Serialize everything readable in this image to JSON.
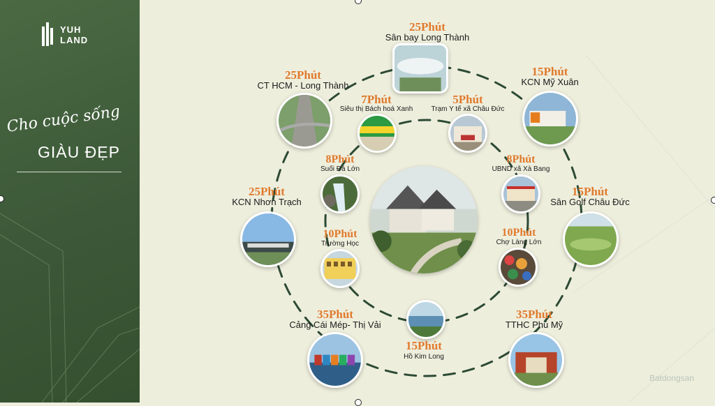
{
  "brand": {
    "line1": "YUH",
    "line2": "LAND"
  },
  "tagline": {
    "script": "Cho cuộc sống",
    "caps": "GIÀU ĐẸP"
  },
  "center": {
    "label": "center-house-render"
  },
  "destinations": [
    {
      "id": "san-bay",
      "time": "25Phút",
      "name": "Sân bay Long Thành"
    },
    {
      "id": "kcn-my-xuan",
      "time": "15Phút",
      "name": "KCN Mỹ Xuân"
    },
    {
      "id": "ct-hcm",
      "time": "25Phút",
      "name": "CT HCM - Long Thành"
    },
    {
      "id": "bach-hoa-xanh",
      "time": "7Phút",
      "name": "Siêu thị Bách hoá Xanh"
    },
    {
      "id": "tram-y-te",
      "time": "5Phút",
      "name": "Trạm Y tế xã Châu Đức"
    },
    {
      "id": "suoi-da-lon",
      "time": "8Phút",
      "name": "Suối Đá Lớn"
    },
    {
      "id": "ubnd",
      "time": "8Phút",
      "name": "UBND xã Xà Bang"
    },
    {
      "id": "kcn-nhon-trach",
      "time": "25Phút",
      "name": "KCN Nhơn Trạch"
    },
    {
      "id": "golf",
      "time": "15Phút",
      "name": "Sân Golf Châu Đức"
    },
    {
      "id": "truong-hoc",
      "time": "10Phút",
      "name": "Trường Học"
    },
    {
      "id": "cho-lang-lon",
      "time": "10Phút",
      "name": "Chợ Làng Lớn"
    },
    {
      "id": "cang-cai-mep",
      "time": "35Phút",
      "name": "Cảng Cái Mép- Thị Vải"
    },
    {
      "id": "ho-kim-long",
      "time": "15Phút",
      "name": "Hồ Kim Long"
    },
    {
      "id": "tthc-phu-my",
      "time": "35Phút",
      "name": "TTHC Phú Mỹ"
    }
  ],
  "watermark": "Batdongsan"
}
